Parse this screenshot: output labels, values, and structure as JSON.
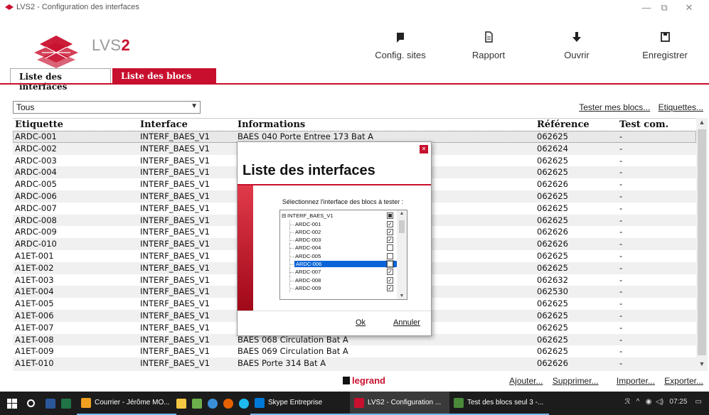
{
  "window": {
    "title": "LVS2 - Configuration des interfaces",
    "minimize": "—",
    "maximize": "⧉",
    "close": "✕"
  },
  "brand": {
    "prefix": "LVS",
    "suffix": "2"
  },
  "toolbar": [
    {
      "label": "Config. sites",
      "icon": "config-sites-icon"
    },
    {
      "label": "Rapport",
      "icon": "document-icon"
    },
    {
      "label": "Ouvrir",
      "icon": "download-arrow-icon"
    },
    {
      "label": "Enregistrer",
      "icon": "save-icon"
    }
  ],
  "tabs": [
    {
      "label": "Liste des interfaces",
      "active": false
    },
    {
      "label": "Liste des blocs",
      "active": true
    }
  ],
  "filter": {
    "value": "Tous"
  },
  "top_links": [
    "Tester mes blocs...",
    "Etiquettes..."
  ],
  "table": {
    "headers": [
      "Etiquette",
      "Interface",
      "Informations",
      "Référence",
      "Test com."
    ],
    "rows": [
      [
        "ARDC-001",
        "INTERF_BAES_V1",
        "BAES 040 Porte Entree 173 Bat A",
        "062625",
        "-"
      ],
      [
        "ARDC-002",
        "INTERF_BAES_V1",
        "",
        "062624",
        "-"
      ],
      [
        "ARDC-003",
        "INTERF_BAES_V1",
        "",
        "062625",
        "-"
      ],
      [
        "ARDC-004",
        "INTERF_BAES_V1",
        "",
        "062625",
        "-"
      ],
      [
        "ARDC-005",
        "INTERF_BAES_V1",
        "",
        "062626",
        "-"
      ],
      [
        "ARDC-006",
        "INTERF_BAES_V1",
        "",
        "062625",
        "-"
      ],
      [
        "ARDC-007",
        "INTERF_BAES_V1",
        "",
        "062625",
        "-"
      ],
      [
        "ARDC-008",
        "INTERF_BAES_V1",
        "",
        "062625",
        "-"
      ],
      [
        "ARDC-009",
        "INTERF_BAES_V1",
        "",
        "062626",
        "-"
      ],
      [
        "ARDC-010",
        "INTERF_BAES_V1",
        "",
        "062626",
        "-"
      ],
      [
        "A1ET-001",
        "INTERF_BAES_V1",
        "",
        "062625",
        "-"
      ],
      [
        "A1ET-002",
        "INTERF_BAES_V1",
        "",
        "062625",
        "-"
      ],
      [
        "A1ET-003",
        "INTERF_BAES_V1",
        "",
        "062632",
        "-"
      ],
      [
        "A1ET-004",
        "INTERF_BAES_V1",
        "",
        "062530",
        "-"
      ],
      [
        "A1ET-005",
        "INTERF_BAES_V1",
        "",
        "062625",
        "-"
      ],
      [
        "A1ET-006",
        "INTERF_BAES_V1",
        "",
        "062625",
        "-"
      ],
      [
        "A1ET-007",
        "INTERF_BAES_V1",
        "",
        "062625",
        "-"
      ],
      [
        "A1ET-008",
        "INTERF_BAES_V1",
        "BAES 068 Circulation Bat A",
        "062625",
        "-"
      ],
      [
        "A1ET-009",
        "INTERF_BAES_V1",
        "BAES 069 Circulation Bat A",
        "062625",
        "-"
      ],
      [
        "A1ET-010",
        "INTERF_BAES_V1",
        "BAES Porte 314 Bat A",
        "062626",
        "-"
      ]
    ]
  },
  "footer": {
    "brand": "legrand",
    "links_left": [
      "Ajouter...",
      "Supprimer..."
    ],
    "links_right": [
      "Importer...",
      "Exporter..."
    ]
  },
  "dialog": {
    "title": "Liste des interfaces",
    "prompt": "Sélectionnez l'interface des blocs à tester :",
    "root": {
      "label": "INTERF_BAES_V1",
      "expander": "⊟",
      "state": "partial"
    },
    "items": [
      {
        "label": "ARDC-001",
        "checked": true
      },
      {
        "label": "ARDC-002",
        "checked": true
      },
      {
        "label": "ARDC-003",
        "checked": true
      },
      {
        "label": "ARDC-004",
        "checked": false
      },
      {
        "label": "ARDC-005",
        "checked": false
      },
      {
        "label": "ARDC-006",
        "checked": false,
        "selected": true
      },
      {
        "label": "ARDC-007",
        "checked": true
      },
      {
        "label": "ARDC-008",
        "checked": true
      },
      {
        "label": "ARDC-009",
        "checked": true
      }
    ],
    "ok": "Ok",
    "cancel": "Annuler"
  },
  "taskbar": {
    "items": [
      {
        "label": "Courrier - Jérôme MO...",
        "color": "#f0a020"
      },
      {
        "label": "Skype Entreprise",
        "color": "#0078d7"
      },
      {
        "label": "LVS2 - Configuration ...",
        "color": "#c8102e"
      },
      {
        "label": "Test des blocs seul 3 -...",
        "color": "#4a8a3a"
      }
    ],
    "clock": "07:25"
  },
  "colors": {
    "accent": "#c8102e",
    "selection": "#0a64d8"
  }
}
